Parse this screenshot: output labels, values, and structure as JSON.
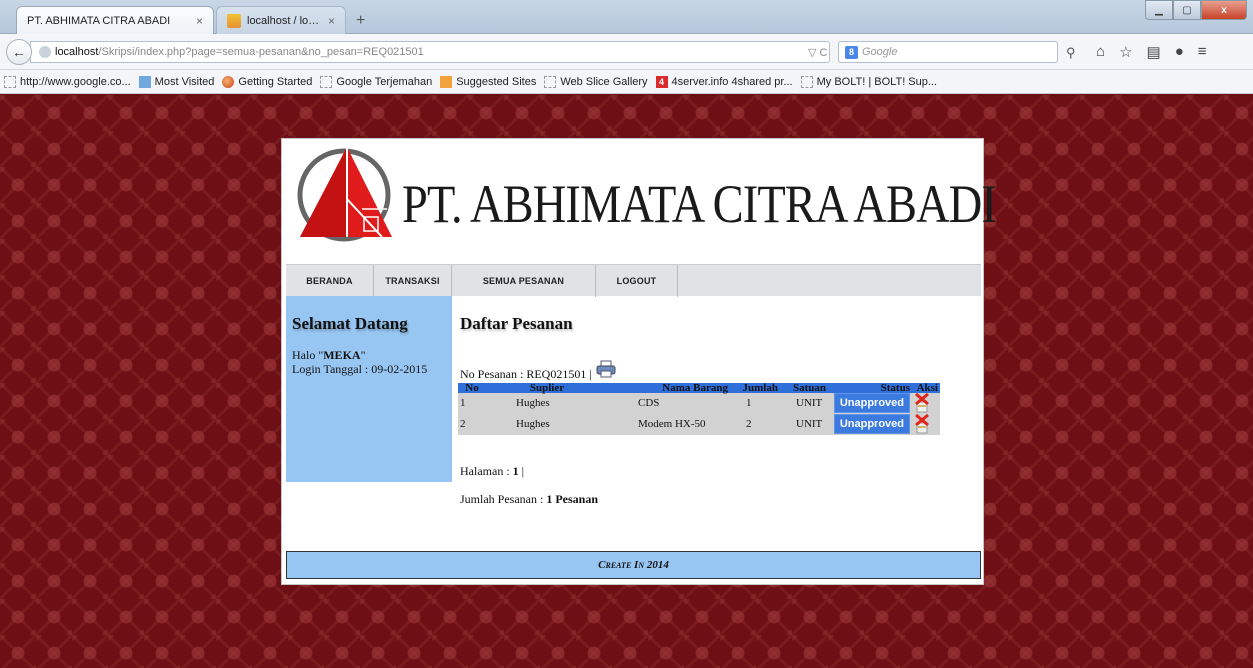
{
  "browser": {
    "tabs": [
      {
        "label": "PT. ABHIMATA CITRA ABADI",
        "active": true
      },
      {
        "label": "localhost / localhost / Skri...",
        "active": false
      }
    ],
    "new_tab": "+",
    "url_host": "localhost",
    "url_path": "/Skripsi/index.php?page=semua-pesanan&no_pesan=REQ021501",
    "url_actions": "▽ C",
    "search_placeholder": "Google",
    "bookmarks": [
      {
        "label": "http://www.google.co...",
        "icon": "blank"
      },
      {
        "label": "Most Visited",
        "icon": "blue"
      },
      {
        "label": "Getting Started",
        "icon": "firefox"
      },
      {
        "label": "Google Terjemahan",
        "icon": "blank"
      },
      {
        "label": "Suggested Sites",
        "icon": "orange"
      },
      {
        "label": "Web Slice Gallery",
        "icon": "blank"
      },
      {
        "label": "4server.info 4shared pr...",
        "icon": "red"
      },
      {
        "label": "My BOLT! | BOLT! Sup...",
        "icon": "blank"
      }
    ]
  },
  "site": {
    "title": "PT. ABHIMATA CITRA ABADI",
    "menu": [
      "BERANDA",
      "TRANSAKSI",
      "SEMUA PESANAN",
      "LOGOUT"
    ],
    "sidebar": {
      "heading": "Selamat Datang",
      "greeting_prefix": "Halo \"",
      "user": "MEKA",
      "greeting_suffix": "\"",
      "login": "Login Tanggal : 09-02-2015"
    },
    "main": {
      "heading": "Daftar Pesanan",
      "order_no": "No Pesanan : REQ021501 |",
      "columns": [
        "No",
        "Suplier",
        "Nama Barang",
        "Jumlah",
        "Satuan",
        "Status",
        "Aksi"
      ],
      "rows": [
        {
          "no": "1",
          "suplier": "Hughes",
          "barang": "CDS",
          "jumlah": "1",
          "satuan": "UNIT",
          "status": "Unapproved"
        },
        {
          "no": "2",
          "suplier": "Hughes",
          "barang": "Modem HX-50",
          "jumlah": "2",
          "satuan": "UNIT",
          "status": "Unapproved"
        }
      ],
      "page_label": "Halaman : ",
      "page_num": "1",
      "page_sep": " |",
      "summary_label": "Jumlah Pesanan : ",
      "summary_value": "1 Pesanan"
    },
    "footer": "Create In 2014"
  },
  "colors": {
    "page_bg": "#6e0f15",
    "sidebar": "#98c6f3",
    "table_header": "#2f6fda",
    "status_button": "#3b7be0",
    "logo_red": "#e01b1b"
  }
}
